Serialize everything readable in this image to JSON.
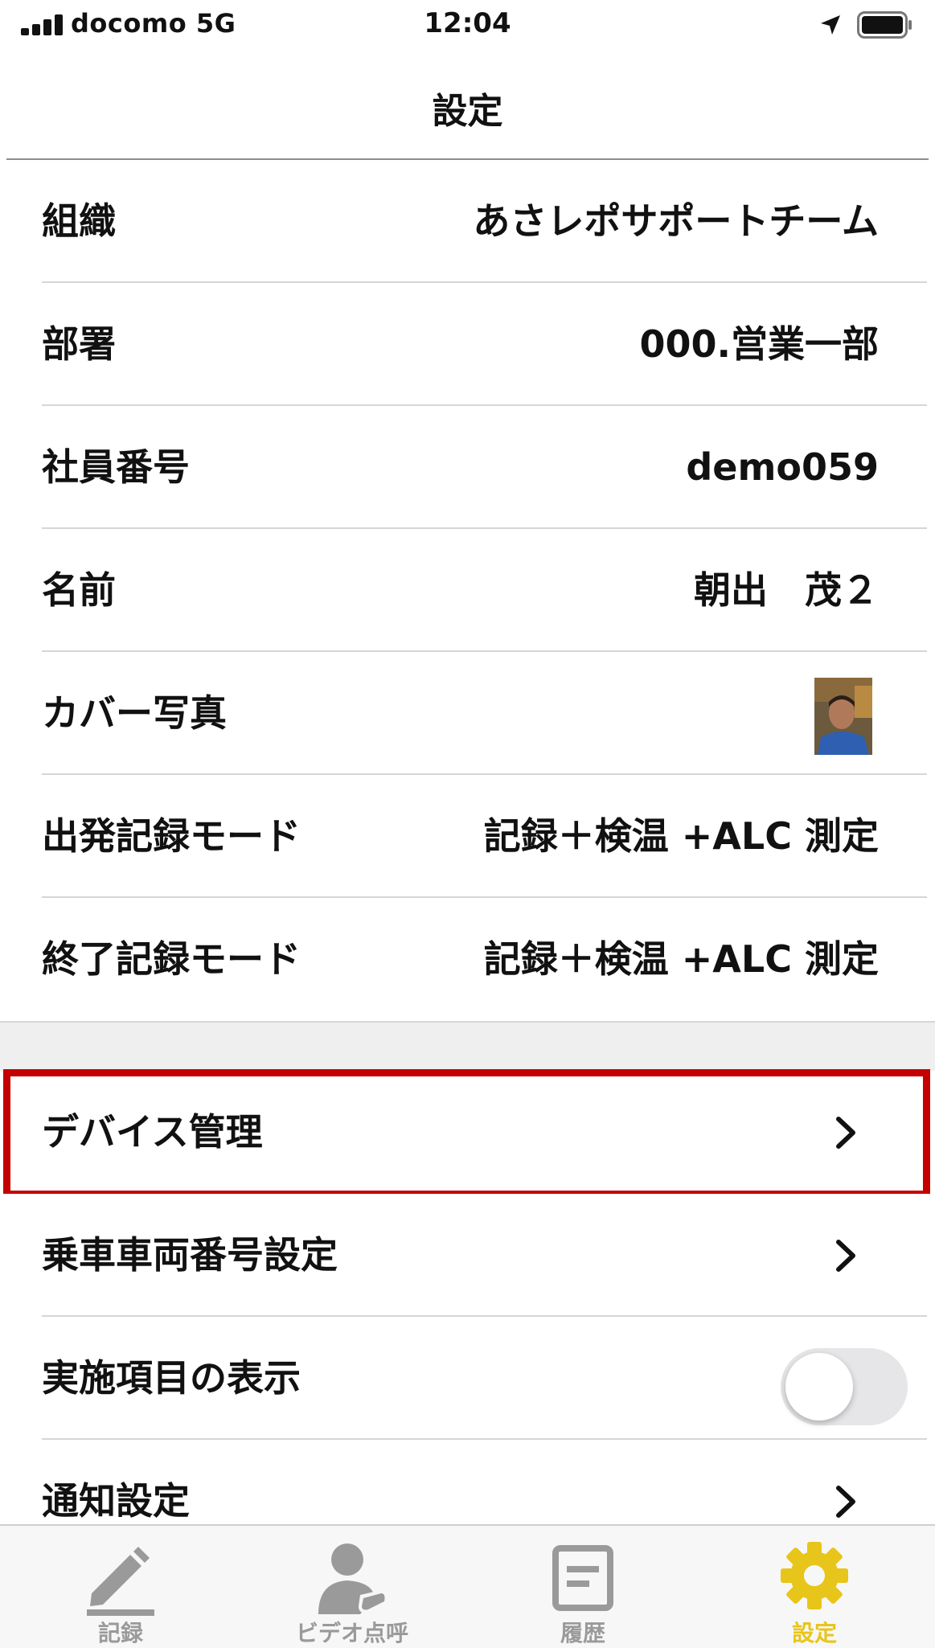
{
  "status_bar": {
    "carrier": "docomo   5G",
    "time": "12:04",
    "icons": [
      "signal-icon",
      "location-arrow-icon",
      "battery-icon"
    ]
  },
  "nav": {
    "title": "設定"
  },
  "settings": {
    "organization": {
      "label": "組織",
      "value": "あさレポサポートチーム"
    },
    "department": {
      "label": "部署",
      "value": "000.営業一部"
    },
    "employee_number": {
      "label": "社員番号",
      "value": "demo059"
    },
    "name": {
      "label": "名前",
      "value": "朝出　茂２"
    },
    "cover_photo": {
      "label": "カバー写真"
    },
    "departure_mode": {
      "label": "出発記録モード",
      "value": "記録＋検温 +ALC 測定"
    },
    "end_mode": {
      "label": "終了記録モード",
      "value": "記録＋検温 +ALC 測定"
    },
    "device_management": {
      "label": "デバイス管理"
    },
    "vehicle_number": {
      "label": "乗車車両番号設定"
    },
    "show_items": {
      "label": "実施項目の表示",
      "enabled": false
    },
    "notification": {
      "label": "通知設定"
    }
  },
  "tabs": [
    {
      "label": "記録",
      "icon": "pencil-icon",
      "active": false
    },
    {
      "label": "ビデオ点呼",
      "icon": "video-call-person-icon",
      "active": false
    },
    {
      "label": "履歴",
      "icon": "history-document-icon",
      "active": false
    },
    {
      "label": "設定",
      "icon": "gear-icon",
      "active": true
    }
  ],
  "colors": {
    "highlight_border": "#c40000",
    "active_tab": "#e8c51a",
    "inactive_tab": "#9a9a9a"
  }
}
